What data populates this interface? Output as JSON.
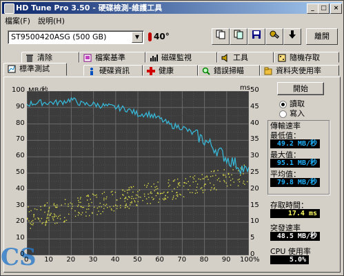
{
  "window": {
    "title": "HD Tune Pro 3.50 - 硬碟檢測-維護工具",
    "minimize": "_",
    "maximize": "□",
    "close": "×"
  },
  "menu": {
    "file": "檔案(F)",
    "help": "說明(H)"
  },
  "toolbar": {
    "drive": "ST9500420ASG (500 GB)",
    "temperature": "40°",
    "exit_label": "離開"
  },
  "tabs_row1": [
    {
      "label": "清除",
      "icon": "trash-icon"
    },
    {
      "label": "檔案基準",
      "icon": "file-benchmark-icon"
    },
    {
      "label": "磁碟監視",
      "icon": "disk-monitor-icon"
    },
    {
      "label": "工具",
      "icon": "speaker-icon"
    },
    {
      "label": "隨機存取",
      "icon": "random-access-icon"
    }
  ],
  "tabs_row2": [
    {
      "label": "標準測試",
      "icon": "benchmark-icon"
    },
    {
      "label": "硬碟資訊",
      "icon": "info-icon"
    },
    {
      "label": "健康",
      "icon": "health-cross-icon"
    },
    {
      "label": "錯誤掃瞄",
      "icon": "magnifier-icon"
    },
    {
      "label": "資料夾使用率",
      "icon": "folder-icon"
    }
  ],
  "chart_labels": {
    "left_unit": "MB/秒",
    "right_unit": "ms"
  },
  "colors": {
    "accent": "#0a246a",
    "plot_bg": "#3c3c3c",
    "transfer_line": "#37b6d6",
    "access_points": "#e0e04a"
  },
  "controls": {
    "start_label": "開始",
    "read_label": "讀取",
    "write_label": "寫入",
    "read_selected": true
  },
  "stats": {
    "transfer_title": "傳輸速率",
    "min_label": "最低值：",
    "min_value": "49.2 MB/秒",
    "max_label": "最大值：",
    "max_value": "95.1 MB/秒",
    "avg_label": "平均值：",
    "avg_value": "79.8 MB/秒",
    "access_label": "存取時間：",
    "access_value": "17.4 ms",
    "burst_label": "突發速率",
    "burst_value": "48.5 MB/秒",
    "cpu_label": "CPU 使用率",
    "cpu_value": "5.0%"
  },
  "watermark": "CS",
  "chart_data": {
    "type": "line",
    "x_tick_labels": [
      "0",
      "10",
      "20",
      "30",
      "40",
      "50",
      "60",
      "70",
      "80",
      "90",
      "100%"
    ],
    "y_left_tick_labels": [
      "0",
      "10",
      "20",
      "30",
      "40",
      "50",
      "60",
      "70",
      "80",
      "90",
      "100"
    ],
    "y_right_tick_labels": [
      "0",
      "5",
      "10",
      "15",
      "20",
      "25",
      "30",
      "35",
      "40",
      "45",
      "50"
    ],
    "xlim": [
      0,
      100
    ],
    "ylim_left": [
      0,
      100
    ],
    "ylim_right": [
      0,
      50
    ],
    "grid": true,
    "series": [
      {
        "name": "讀取",
        "axis": "left",
        "x": [
          0,
          5,
          10,
          15,
          20,
          25,
          30,
          35,
          40,
          45,
          50,
          55,
          60,
          65,
          70,
          75,
          80,
          85,
          90,
          95,
          100
        ],
        "y": [
          92,
          93,
          93,
          93,
          95,
          92,
          92,
          91,
          90,
          89,
          86,
          86,
          83,
          79,
          78,
          74,
          70,
          65,
          59,
          55,
          50
        ]
      },
      {
        "name": "存取時間",
        "axis": "right",
        "kind": "scatter",
        "x_range": [
          0,
          100
        ],
        "y_start": [
          8,
          15
        ],
        "y_end": [
          22,
          28
        ]
      }
    ]
  }
}
